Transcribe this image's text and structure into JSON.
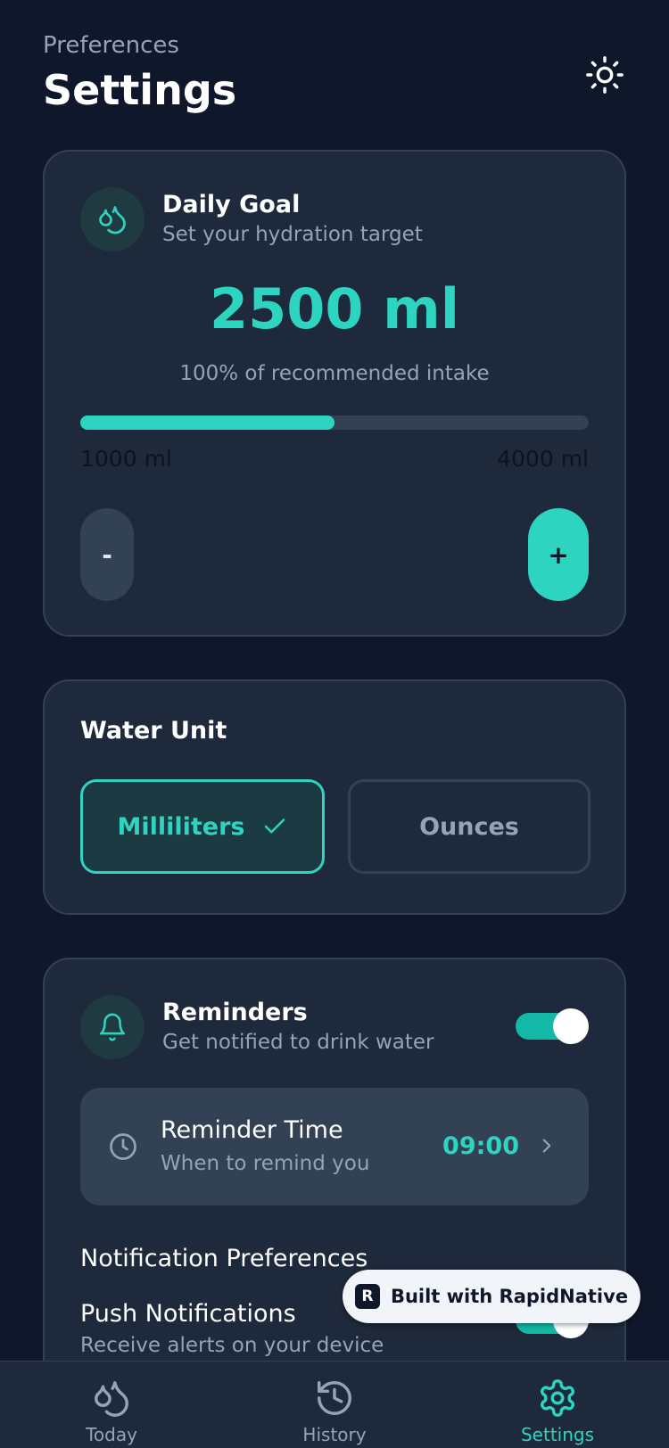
{
  "header": {
    "eyebrow": "Preferences",
    "title": "Settings"
  },
  "daily_goal": {
    "title": "Daily Goal",
    "subtitle": "Set your hydration target",
    "value": "2500 ml",
    "percent_text": "100% of recommended intake",
    "progress_fraction": 0.5,
    "range_min": "1000 ml",
    "range_max": "4000 ml",
    "minus_label": "-",
    "plus_label": "+"
  },
  "water_unit": {
    "title": "Water Unit",
    "options": [
      "Milliliters",
      "Ounces"
    ],
    "selected": "Milliliters"
  },
  "reminders": {
    "title": "Reminders",
    "subtitle": "Get notified to drink water",
    "enabled": true,
    "time_title": "Reminder Time",
    "time_subtitle": "When to remind you",
    "time_value": "09:00",
    "notification_prefs_label": "Notification Preferences",
    "push_title": "Push Notifications",
    "push_subtitle": "Receive alerts on your device",
    "push_enabled": true
  },
  "badge": {
    "text": "Built with RapidNative"
  },
  "tabs": [
    {
      "label": "Today",
      "icon": "droplets-icon",
      "active": false
    },
    {
      "label": "History",
      "icon": "history-icon",
      "active": false
    },
    {
      "label": "Settings",
      "icon": "gear-icon",
      "active": true
    }
  ],
  "colors": {
    "accent": "#2dd4bf",
    "background": "#0f172a",
    "card": "#1e293b"
  }
}
